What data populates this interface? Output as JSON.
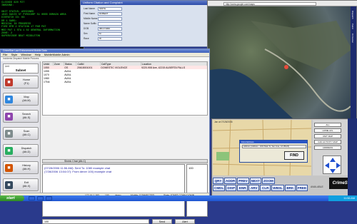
{
  "terminal": {
    "lines": [
      "CLOCKED 820 PZ7",
      "INBOUND: ",
      "",
      "UNIT STATUS: ASSIGNED",
      "1045 DAVIS ST PYROCORP 51 0000 DOMAIN AREA",
      "DISPATCH ID: 03",
      "DR 1 SARG:",
      "MEDICAL IN PROGRESS",
      "FIRE MTR 2 STATION 17 PAR PAT",
      "MED PAT 1 STA 1 02 GENERAL INFORMATION",
      "ZONE: 2",
      "SUPERVISOR BEAT MIDDLETON"
    ]
  },
  "unisess_form": {
    "title": "Uniform Citation and Complaint",
    "labels": [
      "Last Name",
      "First Name",
      "Middle Name",
      "Name Suffix",
      "DOB",
      "Sex",
      "Race"
    ],
    "values": [
      "SMITH",
      "ROBERT",
      "",
      "",
      "08/17/1960",
      "M",
      "W"
    ]
  },
  "browser": {
    "url": "http://www.google.com/maps",
    "side_labels": [
      "Dispatch",
      "Patrol",
      "Crimestar"
    ]
  },
  "mobile": {
    "title": "CrimeStar Law Enforcement Mobile Data",
    "menu": [
      "File",
      "Style",
      "Window",
      "Help",
      "MobileMobile Admin"
    ],
    "tabs": "Incidents  Dispatch Mobile  Pictures",
    "unit_label": "Unit",
    "unit_name": "Subnet",
    "nav": [
      {
        "label": "Home",
        "key": "(F1)",
        "icon": "home-icon",
        "color": "#c0392b"
      },
      {
        "label": "Map",
        "key": "(Alt-M)",
        "icon": "map-icon",
        "color": "#2e86de"
      },
      {
        "label": "Search",
        "key": "(Alt-S)",
        "icon": "search-icon",
        "color": "#8e44ad"
      },
      {
        "label": "Scan",
        "key": "(Alt-C)",
        "icon": "scan-icon",
        "color": "#7f8c8d"
      },
      {
        "label": "Dispatch",
        "key": "(Alt-D)",
        "icon": "dispatch-icon",
        "color": "#27ae60"
      },
      {
        "label": "History",
        "key": "(Alt-H)",
        "icon": "history-icon",
        "color": "#d35400"
      },
      {
        "label": "Exit",
        "key": "(Alt-X)",
        "icon": "exit-icon",
        "color": "#34495e"
      }
    ],
    "table_headers": [
      "Unit#",
      "Zone",
      "Status",
      "CallId",
      "CallType",
      "Location"
    ],
    "rows": [
      [
        "1050",
        "",
        "OS",
        "20618001001",
        "DOMESTIC VIOLENCE",
        "9220-908 Ave, 42215 ALBERTA PALLS"
      ],
      [
        "1055",
        "",
        "AVAIL",
        "",
        "",
        ""
      ],
      [
        "1070",
        "",
        "AVAIL",
        "",
        "",
        ""
      ],
      [
        "1080",
        "",
        "AVAIL",
        "",
        "",
        ""
      ],
      [
        "1TN4",
        "",
        "AVAIL",
        "",
        "",
        ""
      ]
    ],
    "chat_header": "Shrink Chat (Alt-C)",
    "chat_lines": [
      "(07/28/2006 11:56 AM): Sent To: 1080 example chat",
      "(7/28/2006 13:04:07): From dener 100) example chat"
    ],
    "chat_side": "100",
    "chat_input": "100",
    "send_label": "Send",
    "alert_label": "Alert",
    "status": {
      "ip": "172.16.1.193",
      "unit": "100",
      "user": "demo",
      "mobile": "Mobile: CONNECTED",
      "state": "State: START CONN DOWN"
    }
  },
  "avl": {
    "map_header": "Jan at 07/28/2006",
    "dialog_title": "Find Address",
    "dialog_address": "Address (Address : 1024 Main St, San Jose, CA 95126)",
    "find_label": "FIND",
    "right_buttons": [
      "ALL",
      "HOME AVL",
      "UNIT MAP",
      "CAD ACTIVITY MAP",
      "ADDRESS"
    ],
    "row1": [
      "QRY",
      "ADDR",
      "PREV",
      "NEXT",
      "ZOOM"
    ],
    "row2": [
      "CMDL",
      "DISP",
      "ENR",
      "ARV",
      "CLR",
      "WBSL",
      "BRK",
      "FREE"
    ],
    "extra": "AVAILABLE",
    "brand": "CrimeStar"
  },
  "taskbar": {
    "start": "start",
    "clock": "11:56 AM"
  }
}
